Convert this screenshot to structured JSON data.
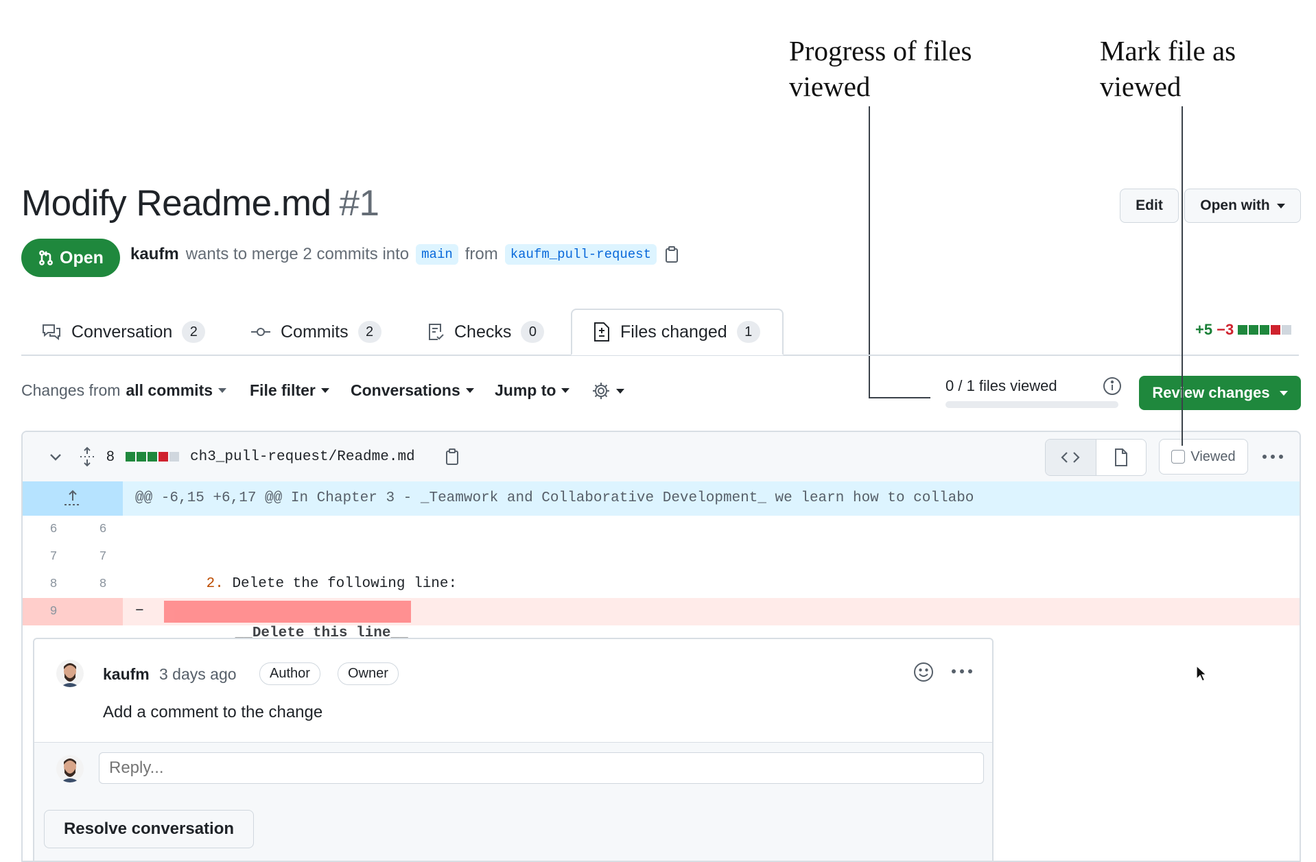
{
  "callouts": {
    "progress": [
      "Progress of files",
      "viewed"
    ],
    "mark": [
      "Mark file as",
      "viewed"
    ]
  },
  "pr": {
    "title": "Modify Readme.md",
    "number": "#1",
    "state": "Open",
    "author": "kaufm",
    "merge_text": "wants to merge 2 commits into",
    "base_branch": "main",
    "from_text": "from",
    "head_branch": "kaufm_pull-request"
  },
  "actions": {
    "edit": "Edit",
    "open_with": "Open with"
  },
  "tabs": [
    {
      "label": "Conversation",
      "count": "2"
    },
    {
      "label": "Commits",
      "count": "2"
    },
    {
      "label": "Checks",
      "count": "0"
    },
    {
      "label": "Files changed",
      "count": "1"
    }
  ],
  "diffstat": {
    "additions": "+5",
    "deletions": "−3"
  },
  "toolbar": {
    "changes_prefix": "Changes from",
    "changes_value": "all commits",
    "file_filter": "File filter",
    "conversations": "Conversations",
    "jump_to": "Jump to"
  },
  "progress": {
    "text": "0 / 1 files viewed",
    "viewed": 0,
    "total": 1
  },
  "review_button": "Review changes",
  "file": {
    "change_count": "8",
    "path": "ch3_pull-request/Readme.md",
    "viewed_label": "Viewed",
    "hunk_header": "@@ -6,15 +6,17 @@ In Chapter 3 - _Teamwork and Collaborative Development_ we learn how to collabo",
    "lines": [
      {
        "old": "6",
        "new": "6",
        "marker": "",
        "num": "",
        "text": ""
      },
      {
        "old": "7",
        "new": "7",
        "marker": "",
        "num": "2.",
        "text": "Delete the following line:"
      },
      {
        "old": "8",
        "new": "8",
        "marker": "",
        "num": "",
        "text": ""
      },
      {
        "old": "9",
        "new": "",
        "marker": "−",
        "num": "",
        "text": "__Delete this line__"
      }
    ]
  },
  "comment": {
    "author": "kaufm",
    "time": "3 days ago",
    "badges": [
      "Author",
      "Owner"
    ],
    "body": "Add a comment to the change",
    "reply_placeholder": "Reply...",
    "resolve_button": "Resolve conversation"
  },
  "colors": {
    "green": "#1f883d",
    "red": "#cf222e",
    "accent_blue": "#0969da"
  }
}
